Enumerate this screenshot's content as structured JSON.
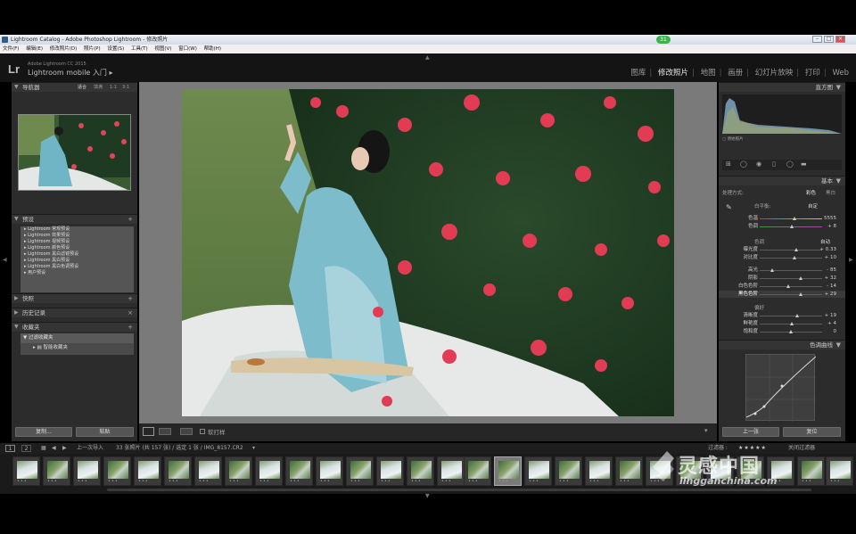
{
  "window": {
    "title": "Lightroom Catalog - Adobe Photoshop Lightroom - 修改照片",
    "badge": "31"
  },
  "menu": [
    "文件(F)",
    "编辑(E)",
    "修改照片(D)",
    "照片(P)",
    "设置(S)",
    "工具(T)",
    "视图(V)",
    "窗口(W)",
    "帮助(H)"
  ],
  "identity": {
    "logo": "Lr",
    "catalog": "Adobe Lightroom CC 2015",
    "mobile": "Lightroom mobile 入门"
  },
  "modules": [
    "图库",
    "修改照片",
    "地图",
    "画册",
    "幻灯片放映",
    "打印",
    "Web"
  ],
  "active_module": "修改照片",
  "left": {
    "navigator": {
      "title": "导航器",
      "modes": [
        "适合",
        "填满",
        "1:1",
        "3:1"
      ]
    },
    "presets": {
      "title": "预设",
      "items": [
        "Lightroom 常规预设",
        "Lightroom 效果预设",
        "Lightroom 视频预设",
        "Lightroom 颜色预设",
        "Lightroom 黑白滤镜预设",
        "Lightroom 黑白预设",
        "Lightroom 黑白色调预设",
        "用户预设"
      ]
    },
    "snapshots": {
      "title": "快照"
    },
    "history": {
      "title": "历史记录"
    },
    "collections": {
      "title": "收藏夹",
      "items": [
        "过滤收藏夹",
        "智能收藏夹"
      ]
    },
    "copy_btn": "复制...",
    "paste_btn": "粘贴"
  },
  "right": {
    "histogram": {
      "title": "直方图",
      "original": "原始照片"
    },
    "basic": {
      "title": "基本",
      "treatment_label": "处理方式:",
      "color_opt": "彩色",
      "bw_opt": "黑白",
      "wb_label": "白平衡:",
      "wb_value": "自定",
      "tone_header": "色调",
      "tone_auto": "自动",
      "presence_header": "偏好",
      "sliders": [
        {
          "label": "色温",
          "value": "5555"
        },
        {
          "label": "色调",
          "value": "+ 8"
        },
        {
          "label": "曝光度",
          "value": "+ 0.33"
        },
        {
          "label": "对比度",
          "value": "+ 10"
        },
        {
          "label": "高光",
          "value": "- 85"
        },
        {
          "label": "阴影",
          "value": "+ 32"
        },
        {
          "label": "白色色阶",
          "value": "- 14"
        },
        {
          "label": "黑色色阶",
          "value": "+ 29"
        },
        {
          "label": "清晰度",
          "value": "+ 19"
        },
        {
          "label": "鲜艳度",
          "value": "+ 4"
        },
        {
          "label": "饱和度",
          "value": "0"
        }
      ],
      "slider_levels": [
        0.55,
        0.52,
        0.58,
        0.56,
        0.2,
        0.66,
        0.46,
        0.65,
        0.6,
        0.52,
        0.5
      ]
    },
    "tonecurve": {
      "title": "色调曲线"
    },
    "prev_btn": "上一张",
    "reset_btn": "复位"
  },
  "toolbar": {
    "softproof": "软打样"
  },
  "filmstrip": {
    "pages": [
      "1",
      "2"
    ],
    "source": "上一次导入",
    "count": "33 张照片 (共 157 张) / 选定 1 张 / IMG_8157.CR2",
    "filter_label": "过滤器 :",
    "filter_off": "关闭过滤器"
  },
  "watermark": {
    "brand": "灵感中国",
    "url": "lingganchina.com"
  }
}
